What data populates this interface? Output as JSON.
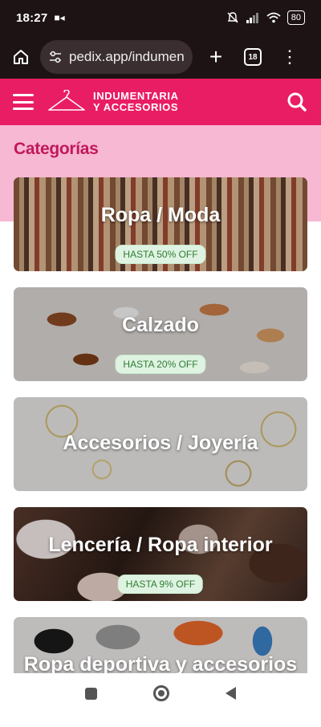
{
  "status_bar": {
    "time": "18:27",
    "battery": "80"
  },
  "browser": {
    "url": "pedix.app/indumenta",
    "tab_count": "18"
  },
  "header": {
    "logo_line1": "INDUMENTARIA",
    "logo_line2": "Y ACCESORIOS"
  },
  "section": {
    "title": "Categorías"
  },
  "categories": [
    {
      "title": "Ropa / Moda",
      "badge": "HASTA 50% OFF"
    },
    {
      "title": "Calzado",
      "badge": "HASTA 20% OFF"
    },
    {
      "title": "Accesorios / Joyería",
      "badge": ""
    },
    {
      "title": "Lencería / Ropa interior",
      "badge": "HASTA 9% OFF"
    },
    {
      "title": "Ropa deportiva y accesorios",
      "badge": ""
    }
  ],
  "colors": {
    "brand": "#e91d63",
    "section_bg": "#f6b8d3",
    "title": "#c2185b",
    "badge_bg": "#dff3e2",
    "badge_text": "#2e7d32"
  },
  "icons": [
    "home-icon",
    "tune-icon",
    "plus-icon",
    "tabs-icon",
    "more-vert-icon",
    "menu-icon",
    "hanger-logo-icon",
    "search-icon"
  ]
}
